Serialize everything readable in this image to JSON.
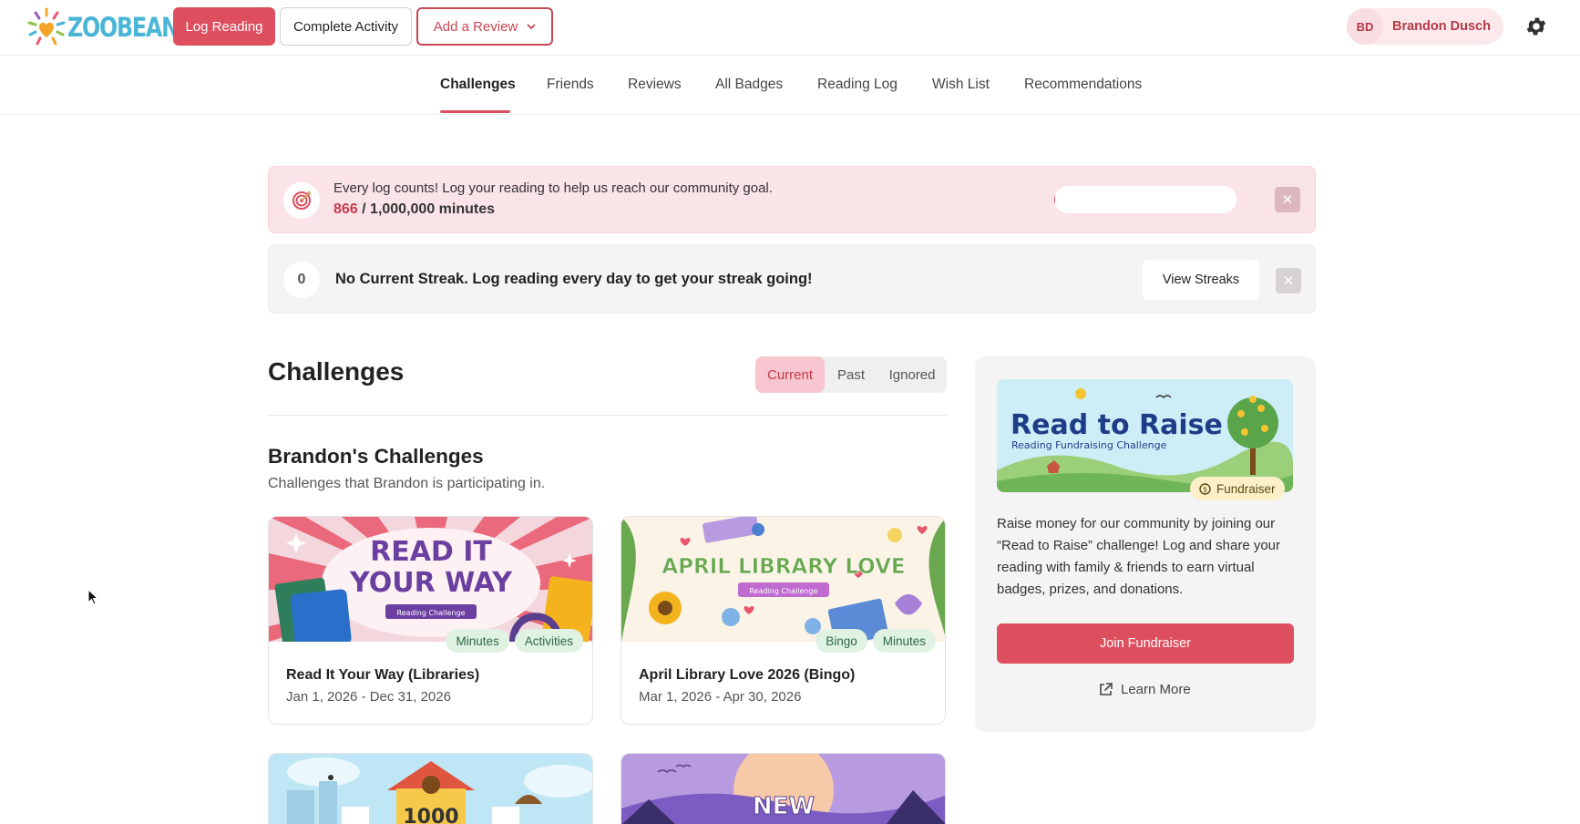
{
  "header": {
    "logo_text": "ZOOBEAN",
    "log_reading_label": "Log Reading",
    "complete_activity_label": "Complete Activity",
    "add_review_label": "Add a Review",
    "user_initials": "BD",
    "user_name": "Brandon Dusch",
    "settings_icon": "gear-icon"
  },
  "nav": {
    "items": [
      {
        "label": "Challenges",
        "active": true
      },
      {
        "label": "Friends"
      },
      {
        "label": "Reviews"
      },
      {
        "label": "All Badges"
      },
      {
        "label": "Reading Log"
      },
      {
        "label": "Wish List"
      },
      {
        "label": "Recommendations"
      }
    ]
  },
  "goal_banner": {
    "message": "Every log counts! Log your reading to help us reach our community goal.",
    "current": "866",
    "target_text": " / 1,000,000 minutes",
    "progress_fraction": 0.000866
  },
  "streak_banner": {
    "count": "0",
    "message": "No Current Streak. Log reading every day to get your streak going!",
    "view_label": "View Streaks"
  },
  "challenges": {
    "title": "Challenges",
    "segments": [
      "Current",
      "Past",
      "Ignored"
    ],
    "active_segment": "Current",
    "section_title": "Brandon's Challenges",
    "section_desc": "Challenges that Brandon is participating in.",
    "cards": [
      {
        "image_lines": [
          "READ IT",
          "YOUR WAY"
        ],
        "image_ribbon": "Reading Challenge",
        "tags": [
          "Minutes",
          "Activities"
        ],
        "name": "Read It Your Way (Libraries)",
        "dates": "Jan 1, 2026 - Dec 31, 2026"
      },
      {
        "image_lines": [
          "APRIL LIBRARY LOVE"
        ],
        "image_ribbon": "Reading Challenge",
        "tags": [
          "Bingo",
          "Minutes"
        ],
        "name": "April Library Love 2026 (Bingo)",
        "dates": "Mar 1, 2026 - Apr 30, 2026"
      }
    ],
    "partial_cards": [
      {
        "image_text": "1000"
      },
      {
        "image_text": "NEW"
      }
    ]
  },
  "fundraiser": {
    "image_title": "Read to Raise",
    "image_subtitle": "Reading Fundraising Challenge",
    "badge": "Fundraiser",
    "description": "Raise money for our community by joining our “Read to Raise” challenge! Log and share your reading with family & friends to earn virtual badges, prizes, and donations.",
    "join_label": "Join Fundraiser",
    "learn_more_label": "Learn More"
  },
  "colors": {
    "accent": "#dd4f5e",
    "accent_dark": "#c53a4a",
    "logo": "#4ab6d6",
    "tag_bg": "#e0f2e4",
    "tag_text": "#2d6a3f"
  }
}
